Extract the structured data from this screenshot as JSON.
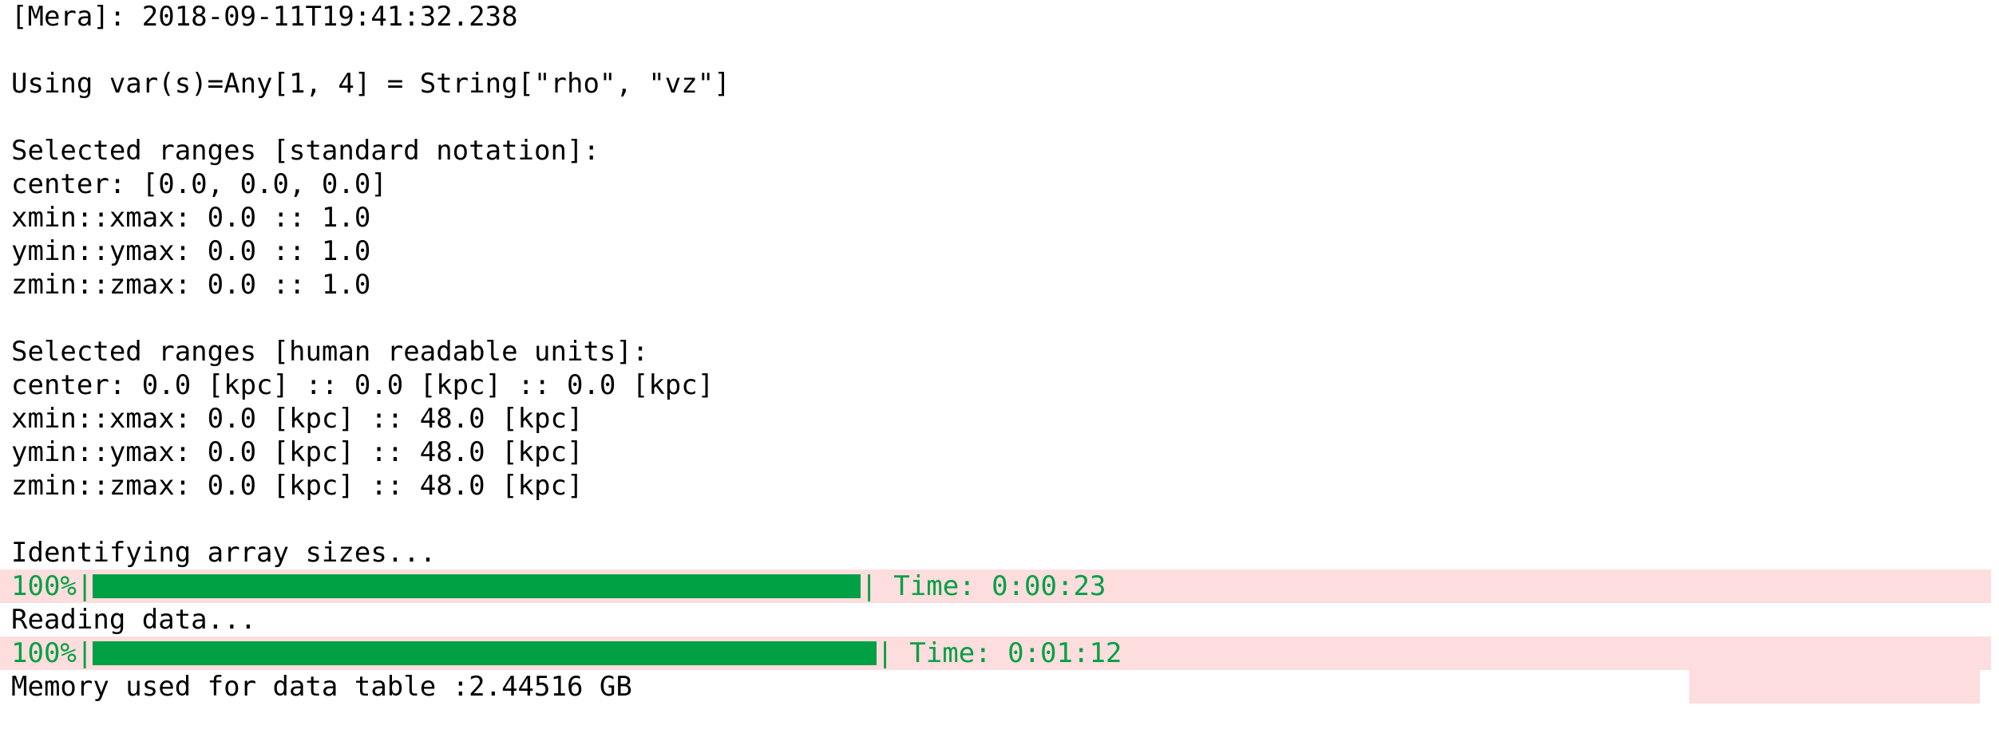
{
  "header_line": "[Mera]: 2018-09-11T19:41:32.238",
  "vars_line": "Using var(s)=Any[1, 4] = String[\"rho\", \"vz\"]",
  "standard": {
    "heading": "Selected ranges [standard notation]:",
    "center": "center: [0.0, 0.0, 0.0]",
    "x": "xmin::xmax: 0.0 :: 1.0",
    "y": "ymin::ymax: 0.0 :: 1.0",
    "z": "zmin::zmax: 0.0 :: 1.0"
  },
  "human": {
    "heading": "Selected ranges [human readable units]:",
    "center": "center: 0.0 [kpc] :: 0.0 [kpc] :: 0.0 [kpc]",
    "x": "xmin::xmax: 0.0 [kpc] :: 48.0 [kpc]",
    "y": "ymin::ymax: 0.0 [kpc] :: 48.0 [kpc]",
    "z": "zmin::zmax: 0.0 [kpc] :: 48.0 [kpc]"
  },
  "progress1": {
    "label": "Identifying array sizes...",
    "percent_text": "100%|",
    "fraction": 1.0,
    "time_text": "| Time: 0:00:23"
  },
  "progress2": {
    "label": "Reading data...",
    "percent_text": "100%|",
    "fraction": 1.0,
    "time_text": "| Time: 0:01:12"
  },
  "memory_line": "Memory used for data table :2.44516 GB",
  "colors": {
    "stderr_background": "#fddddd",
    "progress_green": "#00a045",
    "text": "#000000"
  }
}
